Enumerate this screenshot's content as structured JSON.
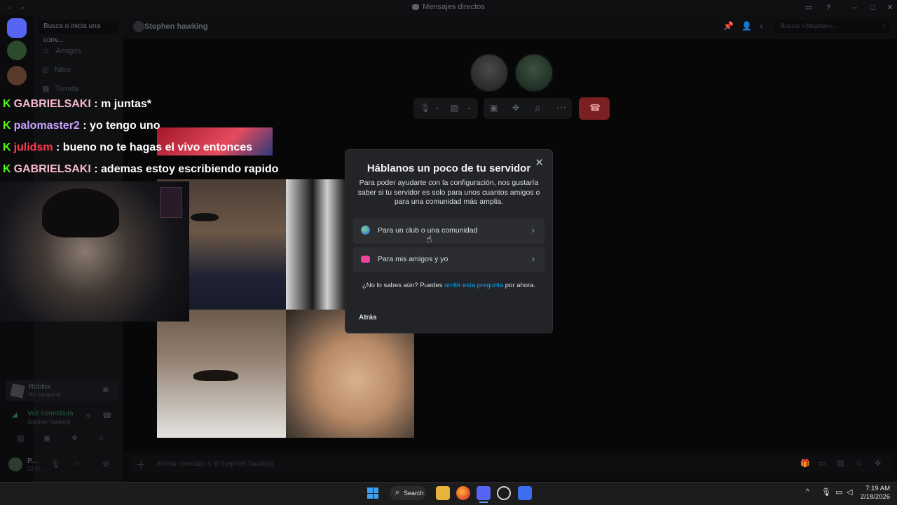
{
  "window": {
    "title": "Mensajes directos"
  },
  "sidebar": {
    "search_placeholder": "Busca o inicia una conv...",
    "items": [
      {
        "label": "Amigos"
      },
      {
        "label": "Nitro"
      },
      {
        "label": "Tienda"
      }
    ],
    "activity": {
      "name": "Roblox",
      "sub": "No compartir"
    },
    "voice": {
      "status": "Voz conectada",
      "channel": "Stephen hawking"
    },
    "user": {
      "name": "P...",
      "sub": "12 Fi..."
    }
  },
  "header": {
    "dm_name": "Stephen hawking",
    "search_placeholder": "Buscar «Stephen»..."
  },
  "composer": {
    "placeholder": "Enviar mensaje a @Stephen hawking"
  },
  "chat_overlay": [
    {
      "user": "GABRIELSAKI",
      "user_color": "#f5b8cf",
      "text": "m juntas*"
    },
    {
      "user": "palomaster2",
      "user_color": "#c9a2ff",
      "text": "yo tengo uno"
    },
    {
      "user": "julidsm",
      "user_color": "#ff3b4a",
      "text": "bueno no te hagas el vivo entonces"
    },
    {
      "user": "GABRIELSAKI",
      "user_color": "#f5b8cf",
      "text": "ademas estoy escribiendo rapido"
    }
  ],
  "modal": {
    "title": "Háblanos un poco de tu servidor",
    "description": "Para poder ayudarte con la configuración, nos gustaría saber si tu servidor es solo para unos cuantos amigos o para una comunidad más amplia.",
    "options": [
      {
        "label": "Para un club o una comunidad",
        "icon": "globe-icon"
      },
      {
        "label": "Para mis amigos y yo",
        "icon": "friends-icon"
      }
    ],
    "hint_prefix": "¿No lo sabes aún? Puedes",
    "hint_link": "omitir esta pregunta",
    "hint_suffix": "por ahora.",
    "back_label": "Atrás"
  },
  "taskbar": {
    "search_label": "Search",
    "time": "7:19 AM",
    "date": "2/18/2026"
  },
  "colors": {
    "accent_link": "#00a8fc",
    "end_call": "#da373c",
    "kick_green": "#53fc18"
  }
}
